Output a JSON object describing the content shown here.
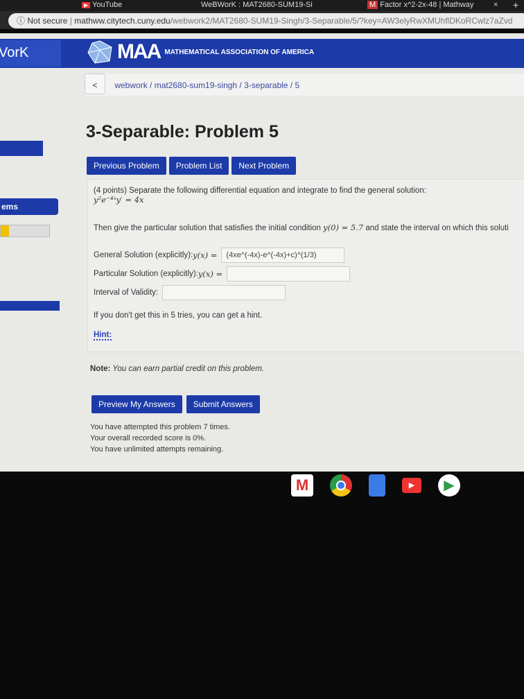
{
  "browser": {
    "tabs": [
      {
        "label": "YouTube"
      },
      {
        "label": "WeBWorK : MAT2680-SUM19-Si"
      },
      {
        "label": "Factor x^2-2x-48 | Mathway"
      }
    ],
    "security": "Not secure",
    "url_host": "mathww.citytech.cuny.edu",
    "url_path": "/webwork2/MAT2680-SUM19-Singh/3-Separable/5/?key=AW3elyRwXMUhflDKoRCwlz7aZvd"
  },
  "header": {
    "brand": "VorK",
    "logo_text": "MAA",
    "logo_subtitle": "MATHEMATICAL ASSOCIATION OF AMERICA"
  },
  "breadcrumb": {
    "back": "<",
    "path": "webwork / mat2680-sum19-singh / 3-separable / 5"
  },
  "sidebar": {
    "item_label": "ems"
  },
  "title": "3-Separable: Problem 5",
  "nav": {
    "prev": "Previous Problem",
    "list": "Problem List",
    "next": "Next Problem"
  },
  "problem": {
    "intro": "(4 points) Separate the following differential equation and integrate to find the general solution:",
    "equation": "y²e⁻⁴ˣy′ = 4x",
    "then_pre": "Then give the particular solution that satisfies the initial condition ",
    "condition": "y(0) = 5.7",
    "then_post": " and state the interval on which this soluti",
    "general_label": "General Solution (explicitly): ",
    "general_math": "y(x) =",
    "general_value": "(4xe^(-4x)-e^(-4x)+c)^(1/3)",
    "particular_label": "Particular Solution (explicitly): ",
    "particular_math": "y(x) =",
    "particular_value": "",
    "interval_label": "Interval of Validity:",
    "interval_value": "",
    "hint_text": "If you don't get this in 5 tries, you can get a hint.",
    "hint_link": "Hint:"
  },
  "note_label": "Note:",
  "note_text": " You can earn partial credit on this problem.",
  "actions": {
    "preview": "Preview My Answers",
    "submit": "Submit Answers"
  },
  "status": [
    "You have attempted this problem 7 times.",
    "Your overall recorded score is 0%.",
    "You have unlimited attempts remaining."
  ],
  "accent": "#1c3aa8"
}
